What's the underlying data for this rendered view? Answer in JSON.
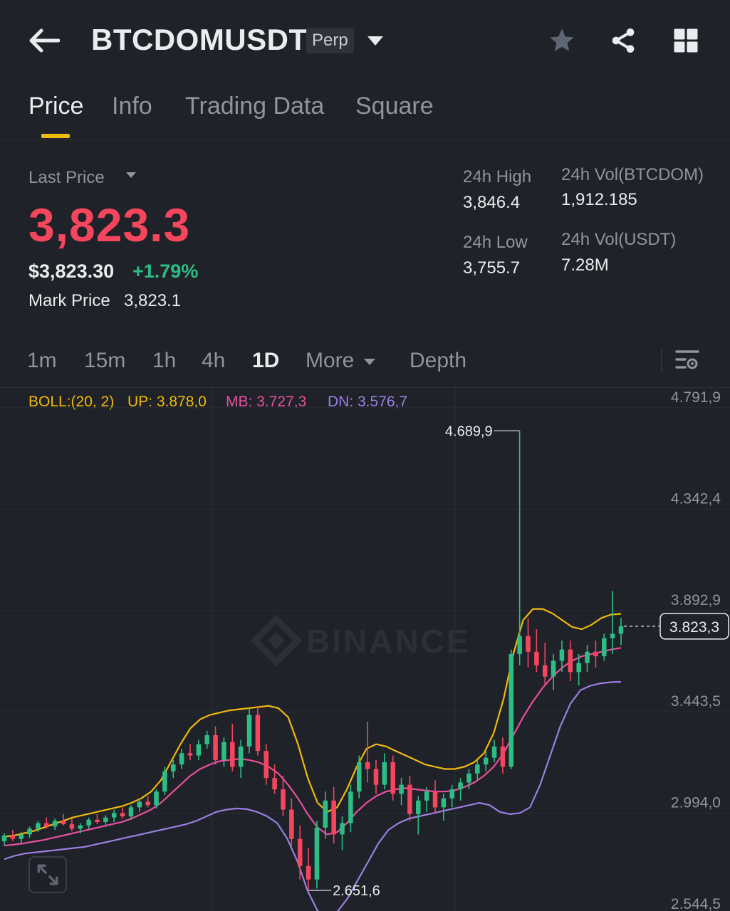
{
  "header": {
    "symbol": "BTCDOMUSDT",
    "badge": "Perp"
  },
  "tabs": [
    {
      "label": "Price"
    },
    {
      "label": "Info"
    },
    {
      "label": "Trading Data"
    },
    {
      "label": "Square"
    }
  ],
  "price": {
    "last_price_label": "Last Price",
    "last_price": "3,823.3",
    "usd_price": "$3,823.30",
    "change_pct": "+1.79%",
    "mark_label": "Mark Price",
    "mark_value": "3,823.1"
  },
  "stats": {
    "high_label": "24h High",
    "high_value": "3,846.4",
    "low_label": "24h Low",
    "low_value": "3,755.7",
    "vol_base_label": "24h Vol(BTCDOM)",
    "vol_base_value": "1,912.185",
    "vol_quote_label": "24h Vol(USDT)",
    "vol_quote_value": "7.28M"
  },
  "intervals": [
    "1m",
    "15m",
    "1h",
    "4h",
    "1D"
  ],
  "more_label": "More",
  "depth_label": "Depth",
  "boll": {
    "label": "BOLL:(20, 2)",
    "up": "UP: 3.878,0",
    "mb": "MB: 3.727,3",
    "dn": "DN: 3.576,7"
  },
  "colors": {
    "up": "#2ebd85",
    "down": "#f6465d",
    "accent": "#f0b90b",
    "boll_up": "#f0b90b",
    "boll_mb": "#e84fa0",
    "boll_dn": "#9a7fe0"
  },
  "chart_data": {
    "type": "candlestick",
    "y_axis_ticks": [
      "4.791,9",
      "4.342,4",
      "3.892,9",
      "3.443,5",
      "2.994,0",
      "2.544,5"
    ],
    "y_tick_values": [
      4791.9,
      4342.4,
      3892.9,
      3443.5,
      2994.0,
      2544.5
    ],
    "current_price_label": "3.823,3",
    "current_price": 3823.3,
    "max_label": "4.689,9",
    "max_value": 4689.9,
    "min_label": "2.651,6",
    "min_value": 2651.6,
    "watermark": "BINANCE",
    "candles": [
      [
        2870,
        2905,
        2850,
        2895
      ],
      [
        2895,
        2920,
        2870,
        2880
      ],
      [
        2880,
        2910,
        2860,
        2900
      ],
      [
        2900,
        2935,
        2885,
        2925
      ],
      [
        2925,
        2960,
        2910,
        2950
      ],
      [
        2950,
        2975,
        2925,
        2935
      ],
      [
        2935,
        2970,
        2920,
        2960
      ],
      [
        2960,
        2990,
        2940,
        2945
      ],
      [
        2945,
        2970,
        2915,
        2925
      ],
      [
        2925,
        2950,
        2905,
        2940
      ],
      [
        2940,
        2975,
        2925,
        2965
      ],
      [
        2965,
        2990,
        2945,
        2955
      ],
      [
        2955,
        2985,
        2935,
        2975
      ],
      [
        2975,
        3010,
        2955,
        2995
      ],
      [
        2995,
        3020,
        2970,
        2980
      ],
      [
        2980,
        3030,
        2965,
        3020
      ],
      [
        3020,
        3060,
        3000,
        3045
      ],
      [
        3045,
        3070,
        3020,
        3030
      ],
      [
        3030,
        3100,
        3015,
        3090
      ],
      [
        3090,
        3200,
        3075,
        3180
      ],
      [
        3180,
        3230,
        3150,
        3210
      ],
      [
        3210,
        3280,
        3190,
        3260
      ],
      [
        3260,
        3300,
        3230,
        3250
      ],
      [
        3250,
        3320,
        3230,
        3300
      ],
      [
        3300,
        3360,
        3280,
        3340
      ],
      [
        3340,
        3380,
        3210,
        3230
      ],
      [
        3230,
        3330,
        3200,
        3310
      ],
      [
        3310,
        3390,
        3180,
        3200
      ],
      [
        3200,
        3320,
        3150,
        3290
      ],
      [
        3290,
        3460,
        3260,
        3430
      ],
      [
        3430,
        3470,
        3250,
        3270
      ],
      [
        3270,
        3300,
        3120,
        3150
      ],
      [
        3150,
        3210,
        3080,
        3100
      ],
      [
        3100,
        3160,
        2980,
        3010
      ],
      [
        3010,
        3060,
        2850,
        2880
      ],
      [
        2880,
        2940,
        2700,
        2760
      ],
      [
        2760,
        2840,
        2655,
        2700
      ],
      [
        2700,
        2960,
        2660,
        2930
      ],
      [
        2930,
        3090,
        2880,
        3050
      ],
      [
        3050,
        3110,
        2860,
        2900
      ],
      [
        2900,
        2980,
        2830,
        2950
      ],
      [
        2950,
        3120,
        2910,
        3090
      ],
      [
        3090,
        3250,
        3060,
        3220
      ],
      [
        3220,
        3400,
        3130,
        3190
      ],
      [
        3190,
        3230,
        3080,
        3120
      ],
      [
        3120,
        3260,
        3100,
        3220
      ],
      [
        3220,
        3250,
        3050,
        3080
      ],
      [
        3080,
        3150,
        3030,
        3120
      ],
      [
        3120,
        3160,
        2960,
        2990
      ],
      [
        2990,
        3070,
        2900,
        3050
      ],
      [
        3050,
        3110,
        3000,
        3090
      ],
      [
        3090,
        3140,
        2990,
        3020
      ],
      [
        3020,
        3080,
        2960,
        3060
      ],
      [
        3060,
        3120,
        3020,
        3100
      ],
      [
        3100,
        3150,
        3050,
        3130
      ],
      [
        3130,
        3190,
        3100,
        3170
      ],
      [
        3170,
        3230,
        3140,
        3210
      ],
      [
        3210,
        3270,
        3180,
        3240
      ],
      [
        3240,
        3320,
        3220,
        3290
      ],
      [
        3290,
        3330,
        3170,
        3200
      ],
      [
        3200,
        3720,
        3190,
        3700
      ],
      [
        3700,
        4689.9,
        3650,
        3780
      ],
      [
        3780,
        3860,
        3640,
        3710
      ],
      [
        3710,
        3810,
        3620,
        3650
      ],
      [
        3650,
        3750,
        3560,
        3600
      ],
      [
        3600,
        3700,
        3540,
        3670
      ],
      [
        3670,
        3760,
        3620,
        3720
      ],
      [
        3720,
        3760,
        3580,
        3620
      ],
      [
        3620,
        3700,
        3560,
        3660
      ],
      [
        3660,
        3740,
        3620,
        3710
      ],
      [
        3710,
        3760,
        3640,
        3690
      ],
      [
        3690,
        3790,
        3670,
        3770
      ],
      [
        3770,
        3980,
        3700,
        3790
      ],
      [
        3790,
        3860,
        3740,
        3823.3
      ]
    ],
    "boll_up": [
      2890,
      2895,
      2905,
      2915,
      2930,
      2945,
      2960,
      2975,
      2985,
      2995,
      3005,
      3015,
      3025,
      3040,
      3060,
      3090,
      3140,
      3220,
      3300,
      3370,
      3410,
      3430,
      3440,
      3450,
      3455,
      3460,
      3465,
      3470,
      3460,
      3420,
      3300,
      3150,
      3040,
      3000,
      3020,
      3100,
      3200,
      3280,
      3300,
      3290,
      3270,
      3250,
      3230,
      3210,
      3200,
      3190,
      3190,
      3200,
      3220,
      3260,
      3350,
      3500,
      3700,
      3850,
      3900,
      3900,
      3880,
      3850,
      3820,
      3810,
      3830,
      3860,
      3875,
      3878
    ],
    "boll_mb": [
      2850,
      2855,
      2860,
      2868,
      2875,
      2885,
      2895,
      2905,
      2915,
      2925,
      2935,
      2945,
      2955,
      2970,
      2990,
      3010,
      3040,
      3080,
      3120,
      3160,
      3190,
      3210,
      3225,
      3230,
      3235,
      3230,
      3220,
      3200,
      3170,
      3120,
      3060,
      2990,
      2930,
      2900,
      2910,
      2950,
      3000,
      3040,
      3070,
      3090,
      3100,
      3105,
      3100,
      3095,
      3090,
      3090,
      3095,
      3110,
      3130,
      3160,
      3200,
      3260,
      3340,
      3420,
      3490,
      3550,
      3600,
      3640,
      3670,
      3690,
      3700,
      3710,
      3720,
      3727.3
    ],
    "boll_dn": [
      2790,
      2805,
      2815,
      2820,
      2825,
      2830,
      2835,
      2840,
      2845,
      2855,
      2865,
      2875,
      2885,
      2895,
      2905,
      2915,
      2925,
      2935,
      2945,
      2960,
      2980,
      3000,
      3010,
      3015,
      3012,
      3000,
      2980,
      2950,
      2880,
      2780,
      2650,
      2560,
      2540,
      2560,
      2620,
      2700,
      2780,
      2860,
      2920,
      2950,
      2970,
      2980,
      2990,
      3000,
      3010,
      3020,
      3030,
      3040,
      3030,
      3000,
      2990,
      2995,
      3020,
      3120,
      3250,
      3380,
      3480,
      3540,
      3560,
      3570,
      3575,
      3576.7
    ]
  }
}
